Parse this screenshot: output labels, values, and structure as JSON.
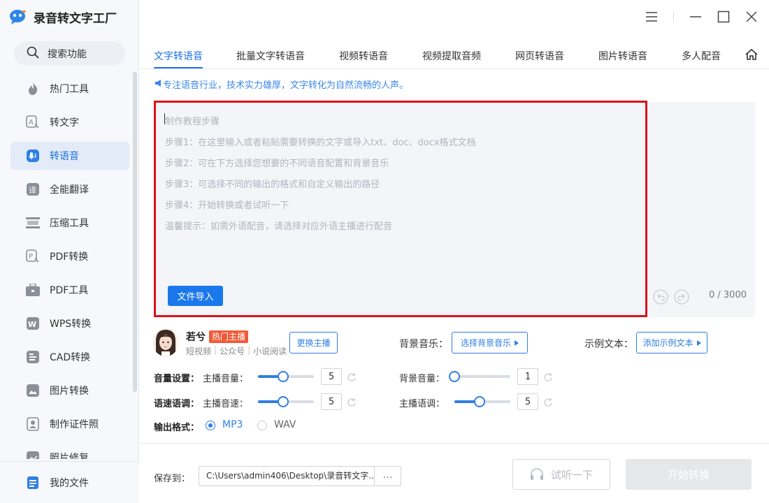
{
  "app": {
    "title": "录音转文字工厂"
  },
  "sidebar": {
    "search_label": "搜索功能",
    "items": [
      {
        "label": "热门工具",
        "icon": "fire-icon"
      },
      {
        "label": "转文字",
        "icon": "text-convert-icon"
      },
      {
        "label": "转语音",
        "icon": "voice-icon",
        "active": true
      },
      {
        "label": "全能翻译",
        "icon": "translate-icon"
      },
      {
        "label": "压缩工具",
        "icon": "compress-icon"
      },
      {
        "label": "PDF转换",
        "icon": "pdf-convert-icon"
      },
      {
        "label": "PDF工具",
        "icon": "toolbox-icon"
      },
      {
        "label": "WPS转换",
        "icon": "wps-icon"
      },
      {
        "label": "CAD转换",
        "icon": "cad-icon"
      },
      {
        "label": "图片转换",
        "icon": "image-icon"
      },
      {
        "label": "制作证件照",
        "icon": "id-photo-icon"
      },
      {
        "label": "照片修复",
        "icon": "photo-repair-icon"
      }
    ],
    "my_files": "我的文件"
  },
  "tabs": [
    "文字转语音",
    "批量文字转语音",
    "视频转语音",
    "视频提取音频",
    "网页转语音",
    "图片转语音",
    "多人配音"
  ],
  "slogan": "专注语音行业，技术实力雄厚，文字转化为自然流畅的人声。",
  "editor": {
    "lines": [
      "制作教程步骤",
      "步骤1：在这里输入或者粘贴需要转换的文字或导入txt、doc、docx格式文档",
      "步骤2：可在下方选择您想要的不同语音配置和背景音乐",
      "步骤3：可选择不同的输出的格式和自定义输出的路径",
      "步骤4：开始转换或者试听一下",
      "温馨提示：如需外语配音，请选择对应外语主播进行配音"
    ],
    "import_label": "文件导入",
    "counter": "0 / 3000"
  },
  "anchor": {
    "name": "若兮",
    "badge": "热门主播",
    "tags": [
      "短视频",
      "公众号",
      "小说阅读"
    ],
    "change_label": "更换主播"
  },
  "bg_music": {
    "label": "背景音乐：",
    "button": "选择背景音乐"
  },
  "sample_text": {
    "label": "示例文本：",
    "button": "添加示例文本"
  },
  "volume": {
    "section": "音量设置：",
    "anchor_label": "主播音量：",
    "anchor_value": "5",
    "anchor_level": 0.44,
    "bg_label": "背景音量：",
    "bg_value": "1",
    "bg_level": 0.0
  },
  "speed": {
    "section": "语速语调：",
    "speed_label": "主播音速：",
    "speed_value": "5",
    "speed_level": 0.44,
    "pitch_label": "主播语调：",
    "pitch_value": "5",
    "pitch_level": 0.44
  },
  "output": {
    "section": "输出格式：",
    "options": [
      "MP3",
      "WAV"
    ],
    "selected": "MP3"
  },
  "save": {
    "label": "保存到：",
    "path": "C:\\Users\\admin406\\Desktop\\录音转文字...",
    "more": "···"
  },
  "actions": {
    "listen": "试听一下",
    "start": "开始转换"
  },
  "colors": {
    "accent": "#1b6fe0",
    "highlight_frame": "#d9141b",
    "badge": "#f15a38"
  }
}
